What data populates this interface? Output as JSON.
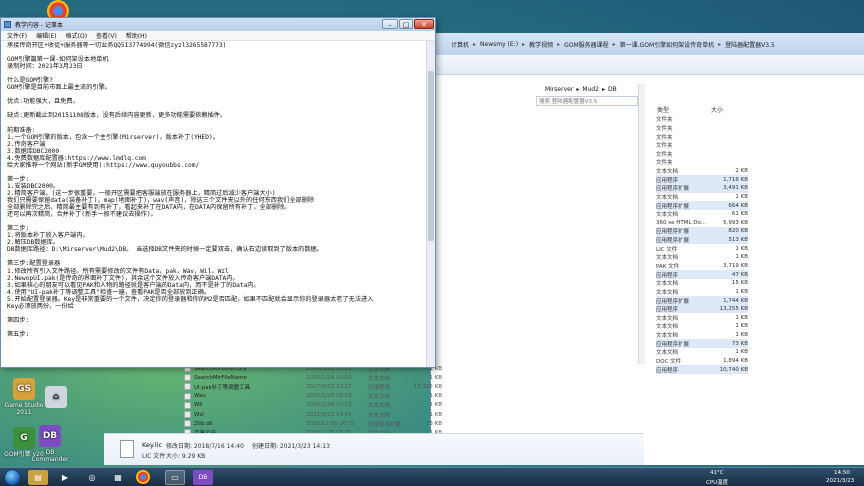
{
  "colors": {
    "desktop": "#2d7f88",
    "window_title": "#bcd3ec",
    "taskbar": "#1f3954",
    "selection": "#dde9f8"
  },
  "notepad": {
    "title": "教学内容 - 记事本",
    "menu": [
      "文件(F)",
      "编辑(E)",
      "格式(O)",
      "查看(V)",
      "帮助(H)"
    ],
    "minimize": "–",
    "maximize": "□",
    "close": "✕",
    "lines": [
      "承接传奇开区+收徒+服务器等一切业务QQ513774994(微信zyzl3265587773)",
      "",
      "GOM引擎篇第一课-如何架设本地单机",
      "录制时间：2021年3月23日",
      "",
      "什么是GOM引擎?",
      "GOM引擎是目前市面上最主流的引擎。",
      "",
      "优点:功能强大，且免费。",
      "",
      "缺点:更新截止到20151108版本，没有后续内容更新，更多功能需要依赖插件。",
      "",
      "前期准备:",
      "1.一个GOM引擎的版本，包含一个主引擎(Mirserver)，版本补丁(YHED)。",
      "2.传奇客户端",
      "3.数据库DBC2000",
      "4.免费数据库配置器:https://www.lmdlq.com",
      "给大家推荐一个网站(新手GM使用):https://www.quyoubbs.com/",
      "",
      "第一步:",
      "1.安装DBC2000。",
      "2.精简客户端。(这一步很重要，一般开区需要把客服端放在服务器上，精简过后减少客户端大小)",
      "我们只需要保留data(装备补丁)，map(地图补丁)，wav(声音)，除这三个文件夹以外的任何东西我们全部删除",
      "全部删除完之后，精简最主要有到有补丁，看起来补丁在DATA内，在DATA内保留所有补丁，全部删除。",
      "还可以再次精简，合并补丁(新手一般不建议去操作)。",
      "",
      "第二步:",
      "1.将版本补丁放入客户端内。",
      "2.解压DB数据库。",
      "DB数据库路径：D:\\Mirserver\\Mud2\\DB。 当选择DB文件夹的时候一定要双击，确认右边读取到了版本的数据。",
      "",
      "第三步:配置登录器",
      "1.修改所有引入文件路径。所有需要修改的文件有Data，pak，Wav，Wil，Wzl",
      "2.NewopUI.pak(是传奇的界面补丁文件)，其余这个文件放入传奇客户端DATA内。",
      "3.如果核心的朋友可以看见PAK和人物的路径就是客户端的Data内，而不是补丁的Data内。",
      "4.使用\"UI-pak补丁等调整工具\"检查一遍，查看PAK是否全部放到正确。",
      "5.开始配置登录器。Key是非常重要的一个文件，决定你的登录器和你的M2是否匹配，如果不匹配就会显示你的登录器太老了无法进入",
      "Key必须放两份，一份给",
      "",
      "第四步:",
      "",
      "第五步:"
    ]
  },
  "explorer": {
    "breadcrumbs": [
      "计算机",
      "Newsmy (E:)",
      "教学视频",
      "GOM服务器课程",
      "第一课.GOM引擎如何架设传奇单机",
      "登陆器配置器V3.5"
    ],
    "subpath": [
      "Mirserver",
      "Mud2",
      "DB"
    ],
    "search_placeholder": "搜索 登陆器配置器V3.5",
    "columns": {
      "type": "类型",
      "size": "大小"
    },
    "right_rows": [
      {
        "type": "文件夹",
        "size": ""
      },
      {
        "type": "文件夹",
        "size": ""
      },
      {
        "type": "文件夹",
        "size": ""
      },
      {
        "type": "文件夹",
        "size": ""
      },
      {
        "type": "文件夹",
        "size": ""
      },
      {
        "type": "文件夹",
        "size": ""
      },
      {
        "type": "文本文档",
        "size": "2 KB"
      },
      {
        "type": "应用程序",
        "size": "1,716 KB"
      },
      {
        "type": "应用程序扩展",
        "size": "3,491 KB"
      },
      {
        "type": "文本文档",
        "size": "1 KB"
      },
      {
        "type": "应用程序扩展",
        "size": "664 KB"
      },
      {
        "type": "文本文档",
        "size": "61 KB"
      },
      {
        "type": "360 se HTML Do...",
        "size": "5,993 KB"
      },
      {
        "type": "应用程序扩展",
        "size": "820 KB"
      },
      {
        "type": "应用程序扩展",
        "size": "513 KB"
      },
      {
        "type": "LIC 文件",
        "size": "1 KB"
      },
      {
        "type": "文本文档",
        "size": "1 KB"
      },
      {
        "type": "PAK 文件",
        "size": "3,719 KB"
      },
      {
        "type": "应用程序",
        "size": "47 KB"
      },
      {
        "type": "文本文档",
        "size": "15 KB"
      },
      {
        "type": "文本文档",
        "size": "1 KB"
      },
      {
        "type": "应用程序扩展",
        "size": "1,744 KB"
      },
      {
        "type": "应用程序",
        "size": "13,255 KB"
      },
      {
        "type": "文本文档",
        "size": "1 KB"
      },
      {
        "type": "文本文档",
        "size": "1 KB"
      },
      {
        "type": "文本文档",
        "size": "1 KB"
      },
      {
        "type": "应用程序扩展",
        "size": "73 KB"
      },
      {
        "type": "文本文档",
        "size": "1 KB"
      },
      {
        "type": "DOC 文件",
        "size": "1,894 KB"
      },
      {
        "type": "应用程序",
        "size": "10,740 KB"
      }
    ],
    "files": [
      {
        "name": "SearchMirDirectory",
        "date": "2020/1/28 15:25",
        "type": "文本文档",
        "size": "1 KB"
      },
      {
        "name": "SearchMirFileName",
        "date": "2020/1/28 15:23",
        "type": "文本文档",
        "size": "1 KB"
      },
      {
        "name": "UI-pak补丁等调整工具",
        "date": "2017/4/23 23:27",
        "type": "应用程序",
        "size": "13,255 KB"
      },
      {
        "name": "Wav",
        "date": "2020/1/28 15:23",
        "type": "文本文档",
        "size": "1 KB"
      },
      {
        "name": "Wil",
        "date": "2020/1/28 15:23",
        "type": "文本文档",
        "size": "1 KB"
      },
      {
        "name": "Wzl",
        "date": "2021/3/23 14:41",
        "type": "文本文档",
        "size": "1 KB"
      },
      {
        "name": "Zlib.dll",
        "date": "2020/11/30 20:31",
        "type": "应用程序扩展",
        "size": "73 KB"
      },
      {
        "name": "变量名用",
        "date": "2020/1/28 15:25",
        "type": "文本文档",
        "size": "1 KB"
      }
    ],
    "details": {
      "name": "Key.lic",
      "type": "LIC 文件",
      "modified_label": "修改日期: 2018/7/16 14:40",
      "created_label": "创建日期: 2021/3/23 14:13",
      "size_label": "大小: 9.29 KB"
    }
  },
  "desktop_icons": [
    {
      "label": "Game Studio 2011",
      "glyph": "GS",
      "color": "#d8a23a"
    },
    {
      "label": "",
      "glyph": "⌂",
      "color": "#cfd6de"
    },
    {
      "label": "GOM引擎 v20",
      "glyph": "G",
      "color": "#3c8f3c"
    },
    {
      "label": "DB Commander",
      "glyph": "DB",
      "color": "#7d4bc2"
    }
  ],
  "taskbar": {
    "tray_temp": "41°C",
    "tray_cpu": "CPU温度",
    "time": "14:50",
    "date": "2021/3/23"
  }
}
